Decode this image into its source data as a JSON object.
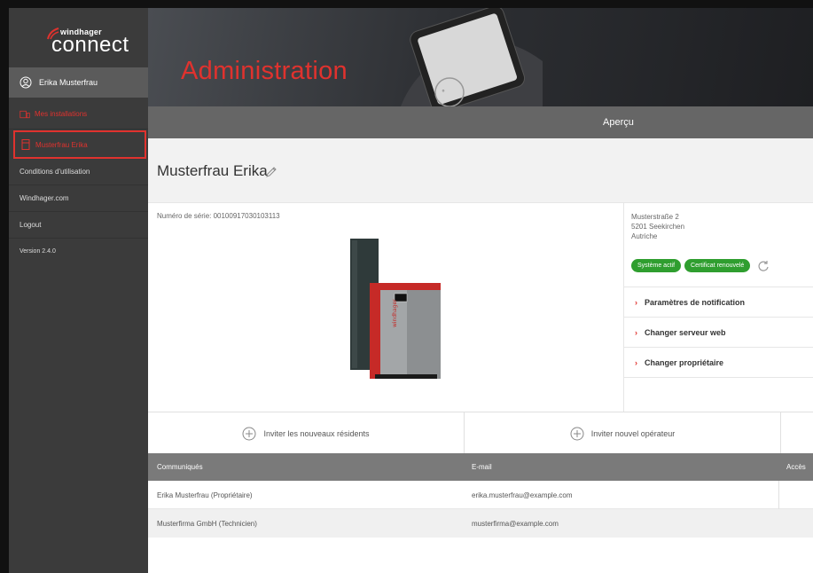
{
  "brand": {
    "top": "windhager",
    "main": "connect"
  },
  "sidebar": {
    "user": "Erika Musterfrau",
    "items": [
      {
        "label": "Mes installations"
      },
      {
        "label": "Musterfrau Erika"
      },
      {
        "label": "Conditions d'utilisation"
      },
      {
        "label": "Windhager.com"
      },
      {
        "label": "Logout"
      },
      {
        "label": "Version 2.4.0"
      }
    ]
  },
  "header": {
    "title": "Administration"
  },
  "subheader": {
    "label": "Aperçu"
  },
  "installation": {
    "name": "Musterfrau Erika",
    "serial": "Numéro de série: 00100917030103113",
    "address": {
      "street": "Musterstraße 2",
      "city": "5201 Seekirchen",
      "country": "Autriche"
    },
    "badges": {
      "system": "Système actif",
      "certificate": "Certificat renouvelé"
    },
    "options": [
      "Paramètres de notification",
      "Changer serveur web",
      "Changer propriétaire"
    ]
  },
  "invites": {
    "residents": "Inviter les nouveaux résidents",
    "operator": "Inviter nouvel opérateur"
  },
  "table": {
    "columns": [
      "Communiqués",
      "E-mail",
      "Accès"
    ],
    "rows": [
      [
        "Erika Musterfrau (Propriétaire)",
        "erika.musterfrau@example.com",
        ""
      ],
      [
        "Musterfirma GmbH (Technicien)",
        "musterfirma@example.com",
        ""
      ]
    ]
  },
  "colors": {
    "accent": "#e0322e",
    "sidebar": "#3b3b3b",
    "badge_green": "#2f9e2f",
    "table_header": "#7a7a7a"
  }
}
